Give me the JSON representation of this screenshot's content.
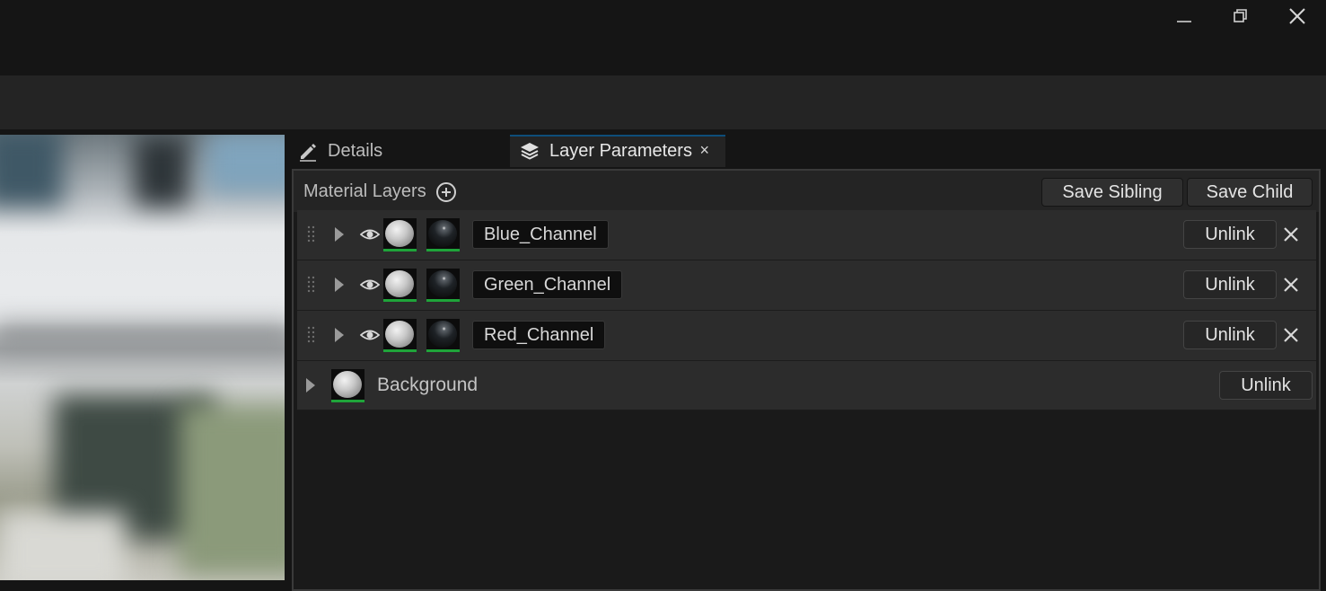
{
  "window": {
    "controls": [
      {
        "name": "minimize-icon"
      },
      {
        "name": "restore-icon"
      },
      {
        "name": "close-icon"
      }
    ]
  },
  "tabs": [
    {
      "label": "Details",
      "icon": "edit-icon",
      "active": false
    },
    {
      "label": "Layer Parameters",
      "icon": "layers-icon",
      "active": true,
      "close": "×"
    }
  ],
  "panel": {
    "title": "Material Layers",
    "add_icon": "add-circle-icon",
    "save_sibling": "Save Sibling",
    "save_child": "Save Child"
  },
  "layers": [
    {
      "name": "Blue_Channel",
      "unlink": "Unlink"
    },
    {
      "name": "Green_Channel",
      "unlink": "Unlink"
    },
    {
      "name": "Red_Channel",
      "unlink": "Unlink"
    }
  ],
  "background": {
    "label": "Background",
    "unlink": "Unlink"
  },
  "colors": {
    "accent_tab": "#0e4d7a",
    "thumb_underline": "#1fa43a",
    "panel_bg": "#242424",
    "row_bg": "#2c2c2c"
  }
}
